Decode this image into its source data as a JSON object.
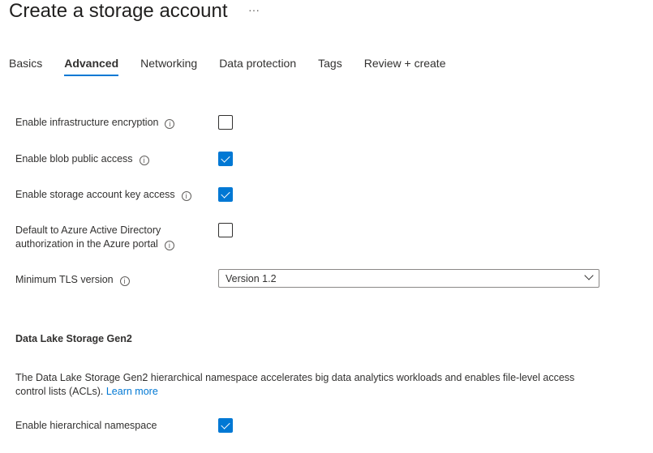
{
  "title": "Create a storage account",
  "more": "···",
  "tabs": [
    "Basics",
    "Advanced",
    "Networking",
    "Data protection",
    "Tags",
    "Review + create"
  ],
  "active_tab": "Advanced",
  "settings": [
    {
      "label": "Enable infrastructure encryption",
      "checked": false
    },
    {
      "label": "Enable blob public access",
      "checked": true
    },
    {
      "label": "Enable storage account key access",
      "checked": true
    },
    {
      "label_line1": "Default to Azure Active Directory",
      "label_line2": "authorization in the Azure portal",
      "checked": false
    }
  ],
  "tls": {
    "label": "Minimum TLS version",
    "value": "Version 1.2"
  },
  "datalake": {
    "heading": "Data Lake Storage Gen2",
    "description": "The Data Lake Storage Gen2 hierarchical namespace accelerates big data analytics workloads and enables file-level access control lists (ACLs).",
    "link": "Learn more",
    "hns_label": "Enable hierarchical namespace",
    "hns_checked": true
  },
  "colors": {
    "accent": "#0078d4"
  }
}
